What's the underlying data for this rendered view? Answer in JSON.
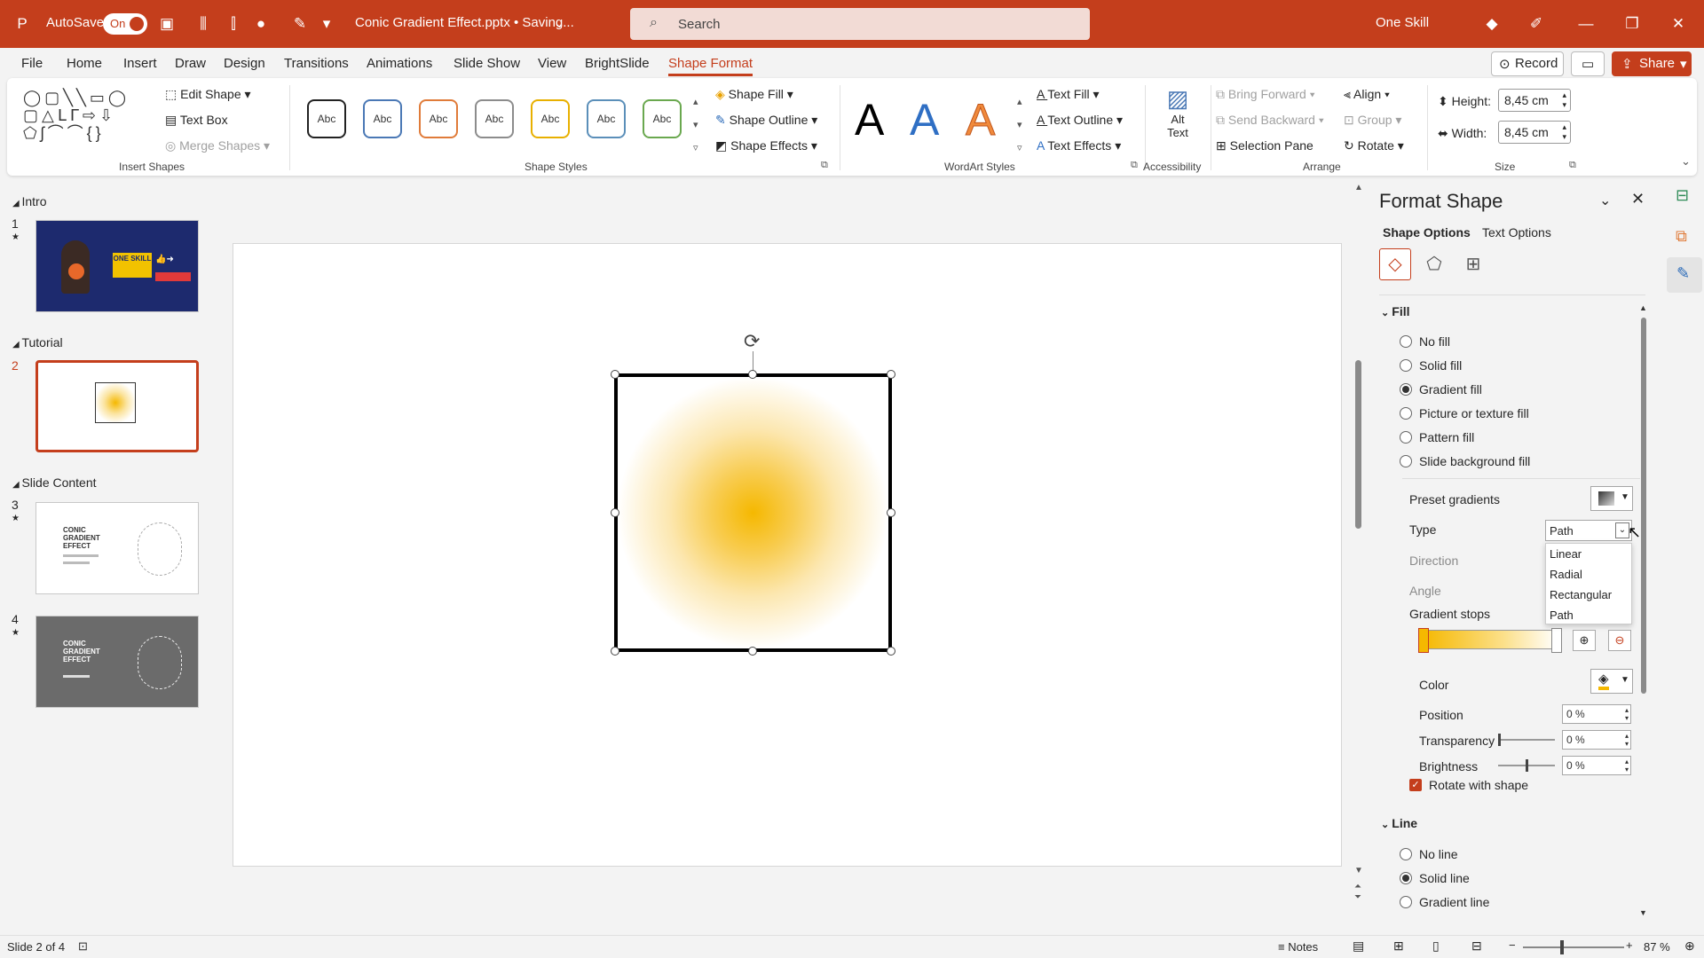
{
  "titlebar": {
    "autosave_label": "AutoSave",
    "autosave_state": "On",
    "doc_title": "Conic Gradient Effect.pptx • Saving...",
    "search_placeholder": "Search",
    "account": "One Skill"
  },
  "tabs": [
    "File",
    "Home",
    "Insert",
    "Draw",
    "Design",
    "Transitions",
    "Animations",
    "Slide Show",
    "View",
    "BrightSlide",
    "Shape Format"
  ],
  "active_tab": "Shape Format",
  "header_buttons": {
    "record": "Record",
    "share": "Share"
  },
  "ribbon": {
    "insert_shapes": {
      "edit_shape": "Edit Shape",
      "text_box": "Text Box",
      "merge_shapes": "Merge Shapes",
      "group": "Insert Shapes"
    },
    "shape_styles": {
      "swatch_label": "Abc",
      "swatch_colors": [
        "#222222",
        "#4a78b5",
        "#e07b39",
        "#8c8c8c",
        "#e8b000",
        "#5b8fb9",
        "#6aa84f"
      ],
      "shape_fill": "Shape Fill",
      "shape_outline": "Shape Outline",
      "shape_effects": "Shape Effects",
      "group": "Shape Styles"
    },
    "wordart": {
      "letters": [
        "A",
        "A",
        "A"
      ],
      "text_fill": "Text Fill",
      "text_outline": "Text Outline",
      "text_effects": "Text Effects",
      "group": "WordArt Styles"
    },
    "accessibility": {
      "alt_text_1": "Alt",
      "alt_text_2": "Text",
      "group": "Accessibility"
    },
    "arrange": {
      "bring_forward": "Bring Forward",
      "send_backward": "Send Backward",
      "selection_pane": "Selection Pane",
      "align": "Align",
      "group_btn": "Group",
      "rotate": "Rotate",
      "group": "Arrange"
    },
    "size": {
      "height_label": "Height:",
      "height_value": "8,45 cm",
      "width_label": "Width:",
      "width_value": "8,45 cm",
      "group": "Size"
    }
  },
  "slides_pane": {
    "sections": [
      {
        "name": "Intro"
      },
      {
        "name": "Tutorial"
      },
      {
        "name": "Slide Content"
      }
    ],
    "slides": [
      {
        "number": "1",
        "thumb_text": "ONE SKILL"
      },
      {
        "number": "2"
      },
      {
        "number": "3",
        "thumb_text": "CONIC GRADIENT EFFECT"
      },
      {
        "number": "4",
        "thumb_text": "CONIC GRADIENT EFFECT"
      }
    ],
    "selected_slide": "2"
  },
  "format_pane": {
    "title": "Format Shape",
    "tab_shape_options": "Shape Options",
    "tab_text_options": "Text Options",
    "fill_header": "Fill",
    "fill_options": [
      "No fill",
      "Solid fill",
      "Gradient fill",
      "Picture or texture fill",
      "Pattern fill",
      "Slide background fill"
    ],
    "fill_selected": "Gradient fill",
    "preset_gradients": "Preset gradients",
    "type_label": "Type",
    "type_value": "Path",
    "direction_label": "Direction",
    "angle_label": "Angle",
    "gradient_stops": "Gradient stops",
    "color_label": "Color",
    "position_label": "Position",
    "position_value": "0 %",
    "transparency_label": "Transparency",
    "transparency_value": "0 %",
    "brightness_label": "Brightness",
    "brightness_value": "0 %",
    "rotate_with_shape": "Rotate with shape",
    "line_header": "Line",
    "line_options": [
      "No line",
      "Solid line",
      "Gradient line"
    ],
    "line_selected": "Solid line",
    "type_dropdown_options": [
      "Linear",
      "Radial",
      "Rectangular",
      "Path"
    ]
  },
  "colors": {
    "accent": "#c43e1c",
    "gradient_center": "#f5b800"
  },
  "status": {
    "slide_counter": "Slide 2 of 4",
    "notes": "Notes",
    "zoom": "87 %"
  }
}
